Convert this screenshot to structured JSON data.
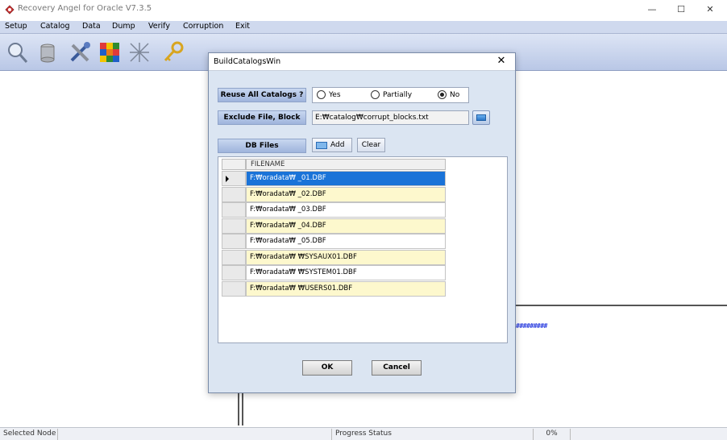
{
  "window": {
    "title": "Recovery Angel for Oracle V7.3.5",
    "minimize_glyph": "—",
    "maximize_glyph": "☐",
    "close_glyph": "✕"
  },
  "menu": {
    "items": [
      {
        "label": "Setup"
      },
      {
        "label": "Catalog"
      },
      {
        "label": "Data"
      },
      {
        "label": "Dump"
      },
      {
        "label": "Verify"
      },
      {
        "label": "Corruption"
      },
      {
        "label": "Exit"
      }
    ]
  },
  "toolbar": {
    "icons": [
      "search-icon",
      "database-icon",
      "tools-icon",
      "cube-icon",
      "network-icon",
      "key-icon"
    ]
  },
  "background": {
    "hash_trail": "#########"
  },
  "dialog": {
    "title": "BuildCatalogsWin",
    "close_glyph": "✕",
    "reuse_label": "Reuse All Catalogs ?",
    "reuse_options": [
      {
        "label": "Yes",
        "selected": false
      },
      {
        "label": "Partially",
        "selected": false
      },
      {
        "label": "No",
        "selected": true
      }
    ],
    "exclude_label": "Exclude File, Block",
    "exclude_value": "E:₩catalog₩corrupt_blocks.txt",
    "db_files_label": "DB Files",
    "add_label": "Add",
    "clear_label": "Clear",
    "grid_header": "FILENAME",
    "files": [
      {
        "name": "F:₩oradata₩        _01.DBF",
        "style": "selected"
      },
      {
        "name": "F:₩oradata₩        _02.DBF",
        "style": "yellow"
      },
      {
        "name": "F:₩oradata₩        _03.DBF",
        "style": "white"
      },
      {
        "name": "F:₩oradata₩        _04.DBF",
        "style": "yellow"
      },
      {
        "name": "F:₩oradata₩        _05.DBF",
        "style": "white"
      },
      {
        "name": "F:₩oradata₩    ₩SYSAUX01.DBF",
        "style": "yellow"
      },
      {
        "name": "F:₩oradata₩    ₩SYSTEM01.DBF",
        "style": "white"
      },
      {
        "name": "F:₩oradata₩    ₩USERS01.DBF",
        "style": "yellow"
      }
    ],
    "ok_label": "OK",
    "cancel_label": "Cancel"
  },
  "status": {
    "selected_node": "Selected Node",
    "progress_status": "Progress Status",
    "percent": "0%"
  }
}
